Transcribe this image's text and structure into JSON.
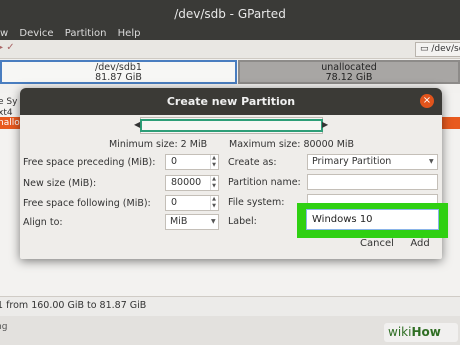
{
  "window": {
    "title": "/dev/sdb - GParted"
  },
  "menubar": {
    "items": [
      "w",
      "Device",
      "Partition",
      "Help"
    ]
  },
  "toolbar": {
    "device_selector": "/dev/sdb"
  },
  "disk_map": {
    "partitions": [
      {
        "name": "/dev/sdb1",
        "size": "81.87 GiB"
      },
      {
        "name": "unallocated",
        "size": "78.12 GiB"
      }
    ]
  },
  "partition_list": {
    "rows": [
      "e Sy",
      "xt4",
      "nalloc"
    ]
  },
  "statusbar": {
    "text": "1 from 160.00 GiB to 81.87 GiB",
    "bottom": "ng"
  },
  "dialog": {
    "title": "Create new Partition",
    "min_size": "Minimum size: 2 MiB",
    "max_size": "Maximum size: 80000 MiB",
    "fields": {
      "free_preceding": {
        "label": "Free space preceding (MiB):",
        "value": "0"
      },
      "new_size": {
        "label": "New size (MiB):",
        "value": "80000"
      },
      "free_following": {
        "label": "Free space following (MiB):",
        "value": "0"
      },
      "align_to": {
        "label": "Align to:",
        "value": "MiB"
      },
      "create_as": {
        "label": "Create as:",
        "value": "Primary Partition"
      },
      "partition_name": {
        "label": "Partition name:",
        "value": ""
      },
      "file_system": {
        "label": "File system:",
        "value": ""
      },
      "label": {
        "label": "Label:",
        "value": "Windows 10"
      }
    },
    "buttons": {
      "cancel": "Cancel",
      "add": "Add"
    }
  },
  "watermark": {
    "wiki": "wiki",
    "how": "How"
  },
  "colors": {
    "accent": "#e85a1f",
    "highlight": "#2fd012",
    "resizer": "#2e9e78"
  }
}
